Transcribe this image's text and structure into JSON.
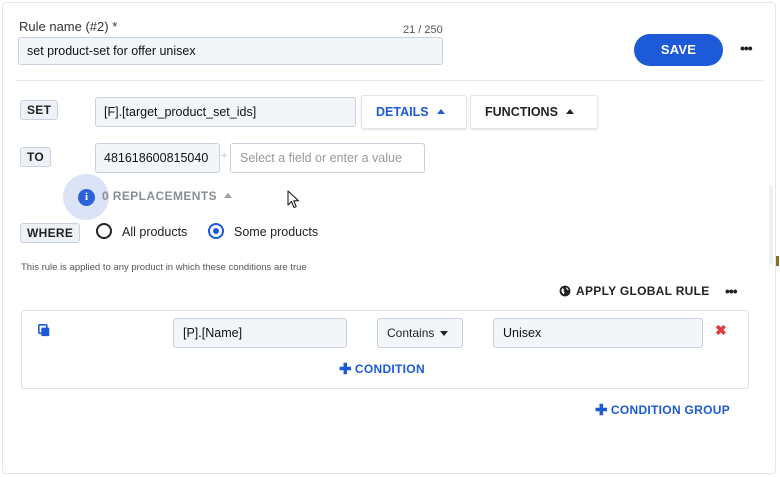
{
  "rule_name": {
    "label": "Rule name (#2) *",
    "value": "set product-set for offer unisex",
    "counter": "21 / 250"
  },
  "header": {
    "save_label": "SAVE",
    "more_label": "•••"
  },
  "set_row": {
    "tag": "SET",
    "field_value": "[F].[target_product_set_ids]",
    "details_label": "DETAILS",
    "functions_label": "FUNCTIONS"
  },
  "to_row": {
    "tag": "TO",
    "value": "481618600815040",
    "separator": "+",
    "input_placeholder": "Select a field or enter a value"
  },
  "replacements": {
    "info_glyph": "i",
    "label": "0 REPLACEMENTS"
  },
  "where": {
    "tag": "WHERE",
    "options": [
      {
        "label": "All products",
        "selected": false
      },
      {
        "label": "Some products",
        "selected": true
      }
    ],
    "hint": "This rule is applied to any product in which these conditions are true"
  },
  "global": {
    "apply_label": "APPLY GLOBAL RULE",
    "more_label": "•••"
  },
  "condition_group": {
    "condition": {
      "field": "[P].[Name]",
      "operator": "Contains",
      "value": "Unisex",
      "remove_glyph": "✖"
    },
    "add_condition_label": "CONDITION",
    "add_group_label": "CONDITION GROUP"
  },
  "colors": {
    "accent": "#1c5ad8",
    "danger": "#e03b3b",
    "input_bg": "#f3f6f9"
  }
}
